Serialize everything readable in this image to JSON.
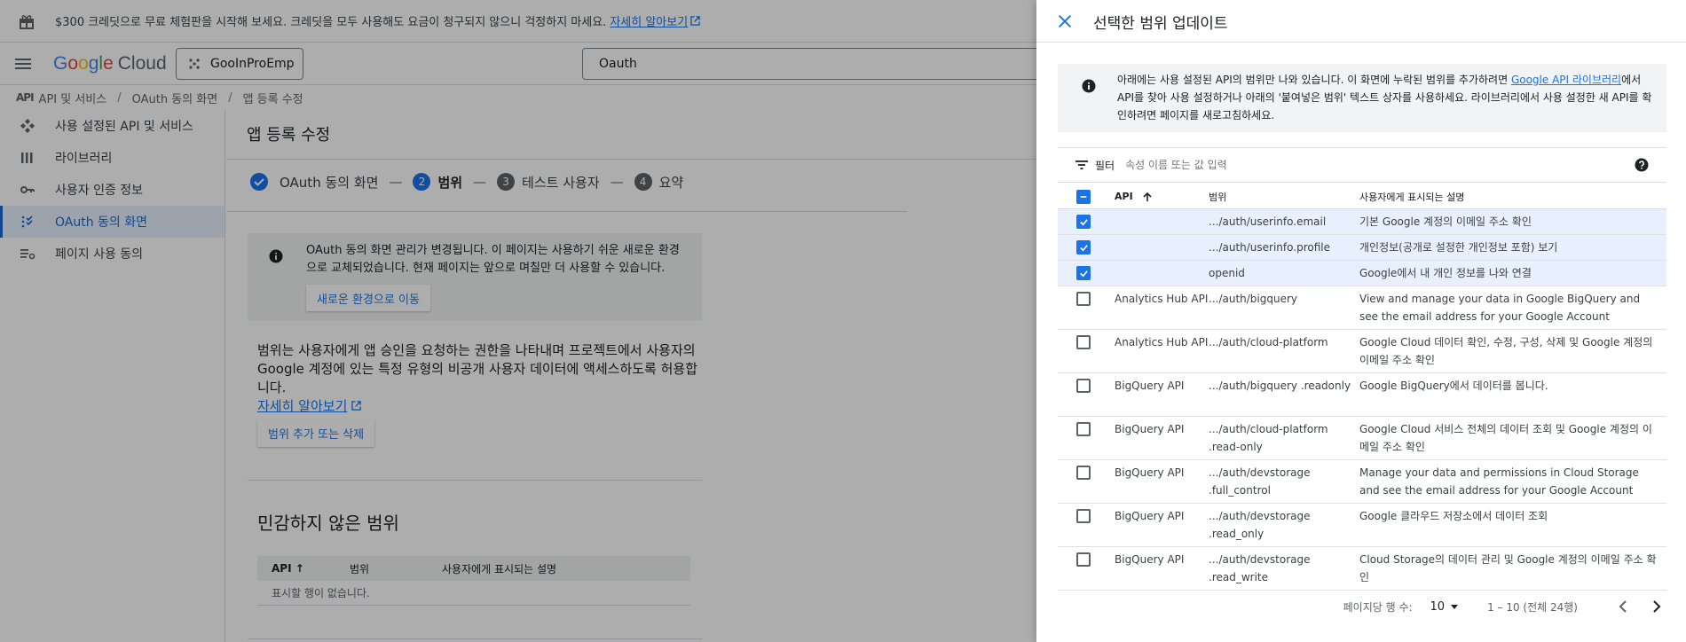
{
  "promo": {
    "text": "$300 크레딧으로 무료 체험판을 시작해 보세요. 크레딧을 모두 사용해도 요금이 청구되지 않으니 걱정하지 마세요.",
    "link": "자세히 알아보기"
  },
  "topbar": {
    "logo_google": [
      "G",
      "o",
      "o",
      "g",
      "l",
      "e"
    ],
    "logo_cloud": "Cloud",
    "project": "GooInProEmp",
    "search_value": "Oauth"
  },
  "breadcrumb": {
    "icon_text": "API",
    "items": [
      "API 및 서비스",
      "OAuth 동의 화면",
      "앱 등록 수정"
    ]
  },
  "sidebar": {
    "items": [
      {
        "label": "사용 설정된 API 및 서비스",
        "icon": "api-diamond-icon"
      },
      {
        "label": "라이브러리",
        "icon": "library-icon"
      },
      {
        "label": "사용자 인증 정보",
        "icon": "key-icon"
      },
      {
        "label": "OAuth 동의 화면",
        "icon": "consent-icon",
        "active": true
      },
      {
        "label": "페이지 사용 동의",
        "icon": "settings-list-icon"
      }
    ]
  },
  "content": {
    "title": "앱 등록 수정",
    "steps": [
      {
        "num": "",
        "label": "OAuth 동의 화면",
        "state": "done"
      },
      {
        "num": "2",
        "label": "범위",
        "state": "current"
      },
      {
        "num": "3",
        "label": "테스트 사용자",
        "state": "todo"
      },
      {
        "num": "4",
        "label": "요약",
        "state": "todo"
      }
    ],
    "notice_text": "OAuth 동의 화면 관리가 변경됩니다. 이 페이지는 사용하기 쉬운 새로운 환경으로 교체되었습니다. 현재 페이지는 앞으로 며칠만 더 사용할 수 있습니다.",
    "notice_button": "새로운 환경으로 이동",
    "scope_desc": "범위는 사용자에게 앱 승인을 요청하는 권한을 나타내며 프로젝트에서 사용자의 Google 계정에 있는 특정 유형의 비공개 사용자 데이터에 액세스하도록 허용합니다.",
    "scope_link": "자세히 알아보기",
    "scope_button": "범위 추가 또는 삭제",
    "non_sensitive_title": "민감하지 않은 범위",
    "mini_headers": [
      "API",
      "범위",
      "사용자에게 표시되는 설명"
    ],
    "mini_empty": "표시할 행이 없습니다."
  },
  "panel": {
    "title": "선택한 범위 업데이트",
    "info_pre": "아래에는 사용 설정된 API의 범위만 나와 있습니다. 이 화면에 누락된 범위를 추가하려면 ",
    "info_link": "Google API 라이브러리",
    "info_post": "에서 API를 찾아 사용 설정하거나 아래의 '붙여넣은 범위' 텍스트 상자를 사용하세요. 라이브러리에서 사용 설정한 새 API를 확인하려면 페이지를 새로고침하세요.",
    "filter_label": "필터",
    "filter_placeholder": "속성 이름 또는 값 입력",
    "headers": {
      "api": "API",
      "scope": "범위",
      "desc": "사용자에게 표시되는 설명"
    },
    "rows": [
      {
        "checked": true,
        "api": "",
        "scope": ".../auth/userinfo.email",
        "desc": "기본 Google 계정의 이메일 주소 확인"
      },
      {
        "checked": true,
        "api": "",
        "scope": ".../auth/userinfo.profile",
        "desc": "개인정보(공개로 설정한 개인정보 포함) 보기"
      },
      {
        "checked": true,
        "api": "",
        "scope": "openid",
        "desc": "Google에서 내 개인 정보를 나와 연결"
      },
      {
        "checked": false,
        "api": "Analytics Hub API",
        "scope": ".../auth/bigquery",
        "desc": "View and manage your data in Google BigQuery and see the email address for your Google Account"
      },
      {
        "checked": false,
        "api": "Analytics Hub API",
        "scope": ".../auth/cloud-platform",
        "desc": "Google Cloud 데이터 확인, 수정, 구성, 삭제 및 Google 계정의 이메일 주소 확인"
      },
      {
        "checked": false,
        "api": "BigQuery API",
        "scope": ".../auth/bigquery .readonly",
        "desc": "Google BigQuery에서 데이터를 봅니다."
      },
      {
        "checked": false,
        "api": "BigQuery API",
        "scope": ".../auth/cloud-platform .read-only",
        "desc": "Google Cloud 서비스 전체의 데이터 조회 및 Google 계정의 이메일 주소 확인"
      },
      {
        "checked": false,
        "api": "BigQuery API",
        "scope": ".../auth/devstorage .full_control",
        "desc": "Manage your data and permissions in Cloud Storage and see the email address for your Google Account"
      },
      {
        "checked": false,
        "api": "BigQuery API",
        "scope": ".../auth/devstorage .read_only",
        "desc": "Google 클라우드 저장소에서 데이터 조회"
      },
      {
        "checked": false,
        "api": "BigQuery API",
        "scope": ".../auth/devstorage .read_write",
        "desc": "Cloud Storage의 데이터 관리 및 Google 계정의 이메일 주소 확인"
      }
    ],
    "pager": {
      "rows_per_page_label": "페이지당 행 수:",
      "rows_per_page": "10",
      "range": "1 – 10 (전체 24행)"
    }
  },
  "colors": {
    "accent": "#1a73e8",
    "overlay": "rgba(0,0,0,0.32)"
  }
}
